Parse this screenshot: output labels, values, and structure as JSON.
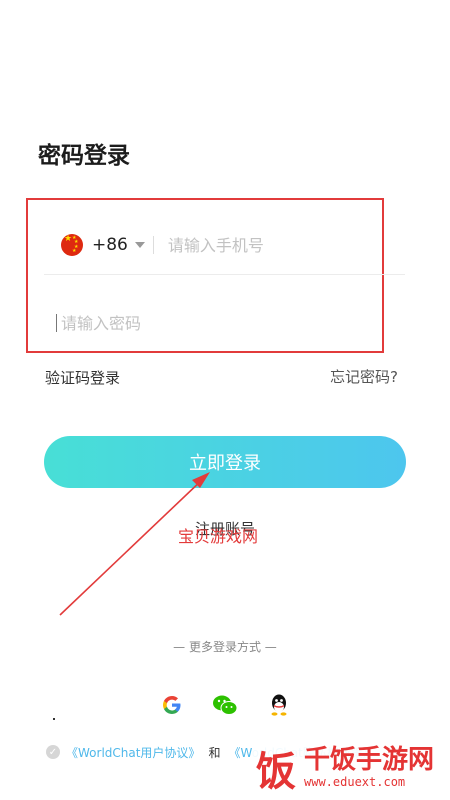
{
  "page": {
    "title": "密码登录"
  },
  "phone": {
    "flag": "china-flag-icon",
    "country_code": "+86",
    "placeholder": "请输入手机号"
  },
  "password": {
    "placeholder": "请输入密码"
  },
  "links": {
    "sms_login": "验证码登录",
    "forgot": "忘记密码?"
  },
  "login_button": "立即登录",
  "register": "注册账号",
  "annotation": "宝贝游戏网",
  "more_login": "— 更多登录方式 —",
  "social": [
    "google-icon",
    "wechat-icon",
    "qq-icon"
  ],
  "agreement": {
    "user_agreement": "《WorldChat用户协议》",
    "and": "和",
    "privacy_policy": "《WorldChat隐私权政策》"
  },
  "watermark": {
    "name": "千饭手游网",
    "url": "www.eduext.com",
    "logo": "饭"
  },
  "colors": {
    "accent": "#4dc6ee",
    "highlight": "#e23b3b",
    "link": "#4fb8ea"
  }
}
